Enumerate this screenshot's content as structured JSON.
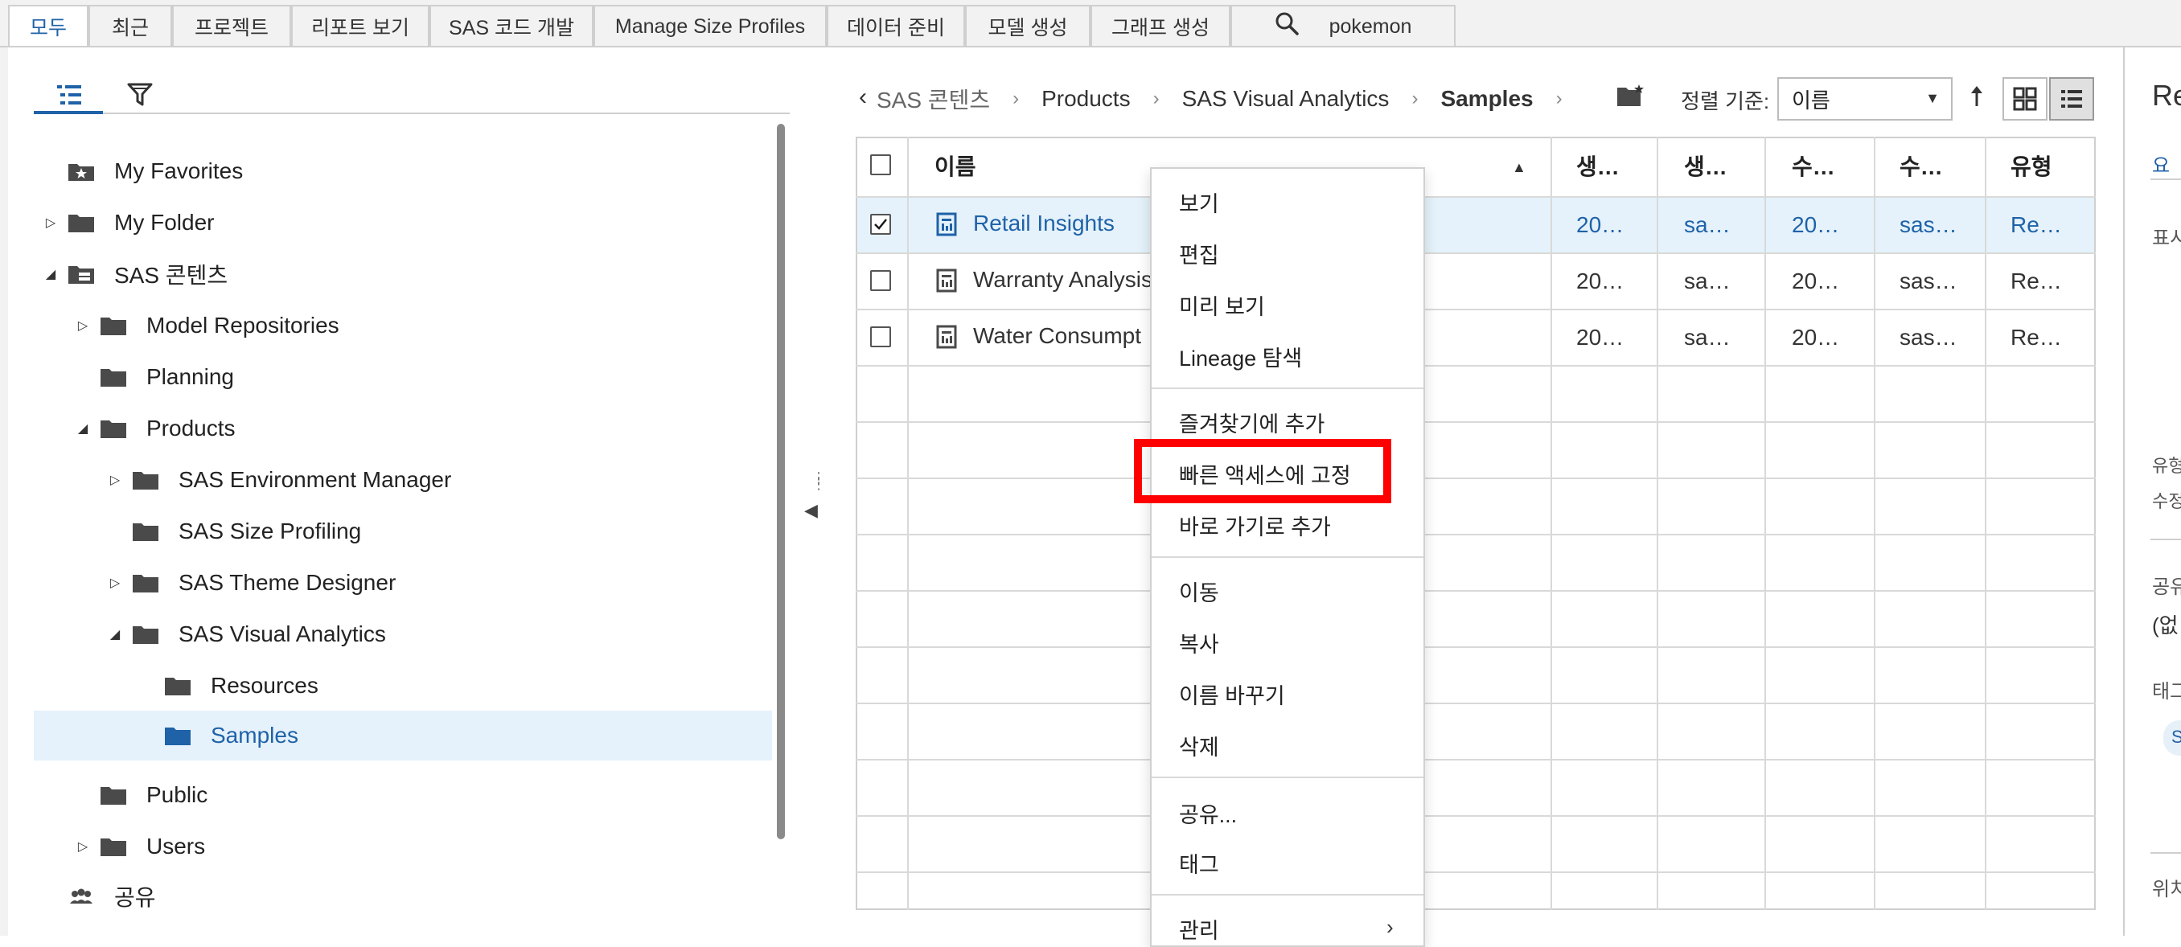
{
  "colors": {
    "accent": "#1f62a8",
    "selected_row": "#e5f2fb",
    "highlight": "#ff0000",
    "border": "#cfcfcf"
  },
  "tabs": [
    {
      "label": "모두",
      "active": true
    },
    {
      "label": "최근"
    },
    {
      "label": "프로젝트"
    },
    {
      "label": "리포트 보기"
    },
    {
      "label": "SAS 코드 개발"
    },
    {
      "label": "Manage Size Profiles"
    },
    {
      "label": "데이터 준비"
    },
    {
      "label": "모델 생성"
    },
    {
      "label": "그래프 생성"
    },
    {
      "label": "pokemon",
      "icon": "search-icon"
    }
  ],
  "tree": {
    "items": [
      {
        "label": "My Favorites",
        "icon": "star-folder-icon"
      },
      {
        "label": "My Folder",
        "icon": "folder-icon",
        "expandable": true
      },
      {
        "label": "SAS 콘텐츠",
        "icon": "server-folder-icon",
        "expanded": true
      },
      {
        "label": "Model Repositories",
        "icon": "folder-icon",
        "expandable": true
      },
      {
        "label": "Planning",
        "icon": "folder-icon"
      },
      {
        "label": "Products",
        "icon": "folder-icon",
        "expanded": true
      },
      {
        "label": "SAS Environment Manager",
        "icon": "folder-icon",
        "expandable": true
      },
      {
        "label": "SAS Size Profiling",
        "icon": "folder-icon"
      },
      {
        "label": "SAS Theme Designer",
        "icon": "folder-icon",
        "expandable": true
      },
      {
        "label": "SAS Visual Analytics",
        "icon": "folder-icon",
        "expanded": true
      },
      {
        "label": "Resources",
        "icon": "folder-icon"
      },
      {
        "label": "Samples",
        "icon": "folder-icon",
        "selected": true
      },
      {
        "label": "Public",
        "icon": "folder-icon"
      },
      {
        "label": "Users",
        "icon": "folder-icon",
        "expandable": true
      },
      {
        "label": "공유",
        "icon": "shared-users-icon"
      }
    ]
  },
  "breadcrumb": {
    "items": [
      "SAS 콘텐츠",
      "Products",
      "SAS Visual Analytics",
      "Samples"
    ]
  },
  "sort": {
    "label": "정렬 기준:",
    "value": "이름"
  },
  "table": {
    "columns": [
      "이름",
      "생…",
      "생…",
      "수…",
      "수…",
      "유형"
    ],
    "rows": [
      {
        "name": "Retail Insights",
        "c1": "20…",
        "c2": "sa…",
        "c3": "20…",
        "c4": "sas…",
        "type": "Re…",
        "selected": true
      },
      {
        "name": "Warranty Analysis",
        "c1": "20…",
        "c2": "sa…",
        "c3": "20…",
        "c4": "sas…",
        "type": "Re…"
      },
      {
        "name": "Water Consumpt",
        "c1": "20…",
        "c2": "sa…",
        "c3": "20…",
        "c4": "sas…",
        "type": "Re…"
      }
    ]
  },
  "context_menu": {
    "items": [
      "보기",
      "편집",
      "미리 보기",
      "Lineage 탐색",
      "즐겨찾기에 추가",
      "빠른 액세스에 고정",
      "바로 가기로 추가",
      "이동",
      "복사",
      "이름 바꾸기",
      "삭제",
      "공유...",
      "태그",
      "관리"
    ],
    "highlighted": "빠른 액세스에 고정"
  },
  "right_panel": {
    "title": "Re",
    "tab": "요",
    "label_display": "표시",
    "label_type": "유형",
    "label_modified": "수정",
    "label_share": "공유",
    "share_value": "(없",
    "label_tags": "태그",
    "tag_pill": "S",
    "label_location": "위치"
  }
}
